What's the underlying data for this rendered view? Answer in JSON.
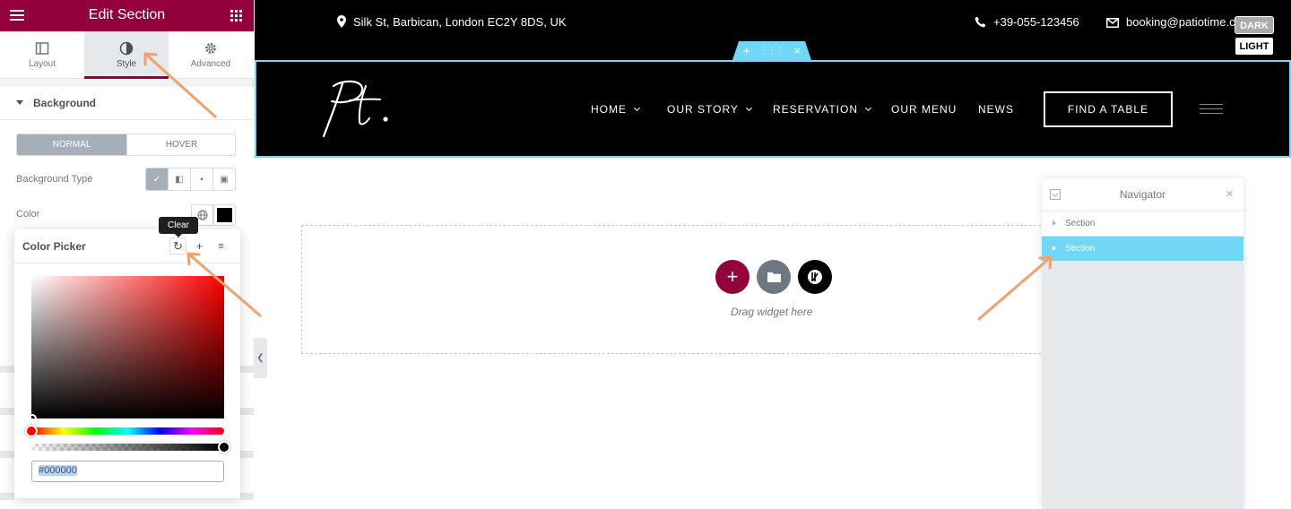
{
  "panel": {
    "title": "Edit Section",
    "tabs": [
      {
        "label": "Layout",
        "icon": "layout-icon"
      },
      {
        "label": "Style",
        "icon": "half-circle-icon"
      },
      {
        "label": "Advanced",
        "icon": "gear-icon"
      }
    ],
    "section_title": "Background",
    "state_toggle": {
      "normal": "NORMAL",
      "hover": "HOVER"
    },
    "background_type_label": "Background Type",
    "color_label": "Color",
    "color_value": "#000000"
  },
  "color_picker": {
    "title": "Color Picker",
    "tooltip": "Clear",
    "hex_value": "#000000"
  },
  "topbar": {
    "address": "Silk St, Barbican, London EC2Y 8DS, UK",
    "phone": "+39-055-123456",
    "email": "booking@patiotime.com"
  },
  "theme_switch": {
    "dark": "DARK",
    "light": "LIGHT"
  },
  "site": {
    "logo": "Pt.",
    "nav": [
      {
        "label": "HOME",
        "dropdown": true
      },
      {
        "label": "OUR STORY",
        "dropdown": true
      },
      {
        "label": "RESERVATION",
        "dropdown": true
      },
      {
        "label": "OUR MENU",
        "dropdown": false
      },
      {
        "label": "NEWS",
        "dropdown": false
      }
    ],
    "cta": "FIND A TABLE"
  },
  "empty_section": {
    "drag_text": "Drag widget here"
  },
  "navigator": {
    "title": "Navigator",
    "items": [
      {
        "label": "Section",
        "selected": false
      },
      {
        "label": "Section",
        "selected": true
      }
    ]
  },
  "colors": {
    "brand": "#93003c",
    "selection": "#71d7f7",
    "annotation_arrow": "#f5a06b"
  }
}
